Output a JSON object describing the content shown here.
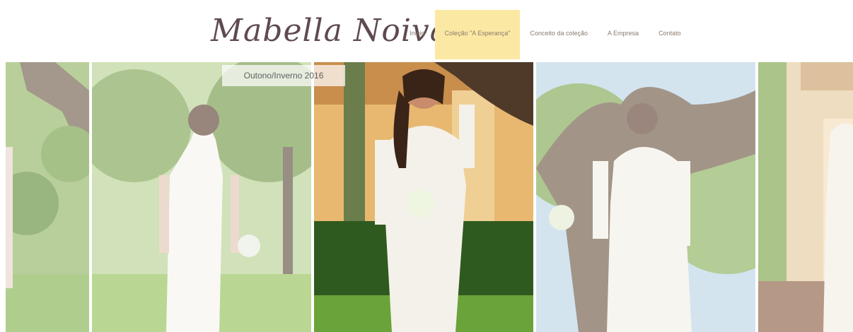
{
  "brand": {
    "logo_text": "Mabella Noiva"
  },
  "nav": {
    "items": [
      {
        "label": "Início",
        "active": false
      },
      {
        "label": "Coleção \"A Esperança\"",
        "active": true
      },
      {
        "label": "Conceito da coleção",
        "active": false
      },
      {
        "label": "A Empresa",
        "active": false
      },
      {
        "label": "Contato",
        "active": false
      }
    ]
  },
  "hero": {
    "season_label": "Outono/Inverno 2016"
  },
  "colors": {
    "accent": "#fbe8a3",
    "logo": "#5e4a4f",
    "nav_text": "#8b7a6e"
  },
  "photos": [
    {
      "name": "photo-tree-left",
      "active": false
    },
    {
      "name": "photo-bride-back-garden",
      "active": false
    },
    {
      "name": "photo-bride-front-smiling",
      "active": true
    },
    {
      "name": "photo-bride-back-tree",
      "active": false
    },
    {
      "name": "photo-bride-building-right",
      "active": false
    }
  ]
}
